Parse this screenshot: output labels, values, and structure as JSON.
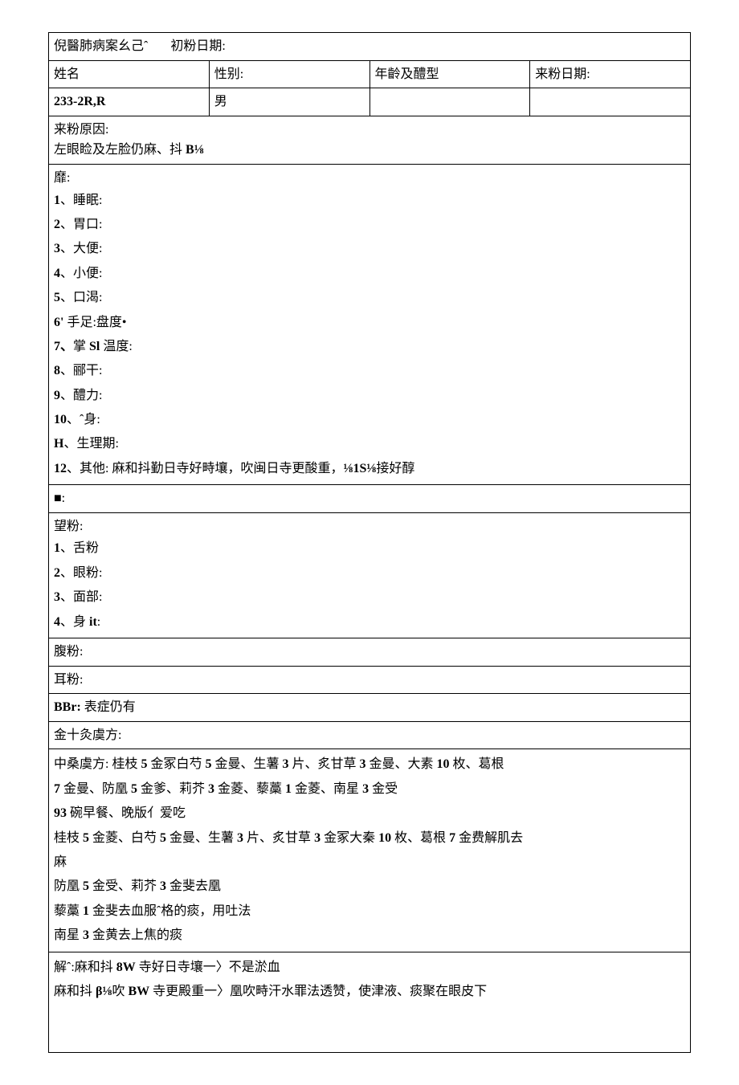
{
  "header": {
    "title_prefix": "倪醫肺病案幺己ˆ",
    "init_date_label": "初粉日期:"
  },
  "row2": {
    "name_label": "姓名",
    "sex_label": "性别:",
    "age_label": "年齡及醴型",
    "visit_date_label": "来粉日期:"
  },
  "row3": {
    "code": "233-2R,R",
    "sex": "男"
  },
  "reason": {
    "label": "来粉原因:",
    "text": "左眼睑及左脸仍麻、抖 B⅛"
  },
  "symptoms": {
    "label": "靡:",
    "items": [
      {
        "no": "1",
        "txt": "、睡眠:"
      },
      {
        "no": "2",
        "txt": "、胃口:"
      },
      {
        "no": "3",
        "txt": "、大便:"
      },
      {
        "no": "4",
        "txt": "、小便:"
      },
      {
        "no": "5",
        "txt": "、口渴:"
      },
      {
        "no": "6'",
        "txt": " 手足:盘度•"
      },
      {
        "no": "7、",
        "txt": "掌 Sl 温度:"
      },
      {
        "no": "8",
        "txt": "、郦干:"
      },
      {
        "no": "9",
        "txt": "、醴力:"
      },
      {
        "no": "10",
        "txt": "、ˆ身:"
      },
      {
        "no": "H",
        "txt": "、生理期:"
      },
      {
        "no": "12",
        "txt": "、其他: 麻和抖勤日寺好畤壤，吹闽日寺更酸重，⅛1S⅛接好醇"
      }
    ]
  },
  "block": "■:",
  "wang": {
    "label": "望粉:",
    "items": [
      {
        "no": "1",
        "txt": "、舌粉"
      },
      {
        "no": "2",
        "txt": "、眼粉:"
      },
      {
        "no": "3",
        "txt": "、面部:"
      },
      {
        "no": "4",
        "txt": "、身 it:"
      }
    ]
  },
  "fu": "腹粉:",
  "er": "耳粉:",
  "bbr": {
    "label": "BBr: ",
    "txt": "表症仍有"
  },
  "rx_label": "金十灸虞方:",
  "rx_lines": [
    "中桑虞方: 桂枝 <b>5</b> 金冢白芍 <b>5</b> 金曼、生薯 <b>3</b> 片、炙甘草 <b>3</b> 金曼、大素 <b>10</b> 枚、葛根",
    "<b>7</b> 金曼、防凰 <b>5</b> 金爹、莉芥 <b>3</b> 金菱、藜藁 <b>1</b> 金菱、南星 <b>3</b> 金受",
    "<b>93</b> 碗早餐、晚版亻爱吃",
    "桂枝 <b>5</b> 金菱、白芍 <b>5</b> 金曼、生薯 <b>3</b> 片、炙甘草 <b>3</b> 金冢大秦 <b>10</b> 枚、葛根 <b>7</b> 金费解肌去",
    "麻",
    "防凰 <b>5</b> 金受、莉芥 <b>3</b> 金斐去凰",
    "藜藁 <b>1</b> 金斐去血服ˆ格的痰，用吐法",
    "南星 <b>3</b> 金黄去上焦的痰"
  ],
  "jie_lines": [
    "解ˆ:麻和抖 <b>8W</b> 寺好日寺壤一〉不是淤血",
    "麻和抖 <b>β⅛</b>吹 <b>BW</b> 寺更殿重一〉凰吹畤汗水罪法透赞，使津液、痰聚在眼皮下"
  ]
}
